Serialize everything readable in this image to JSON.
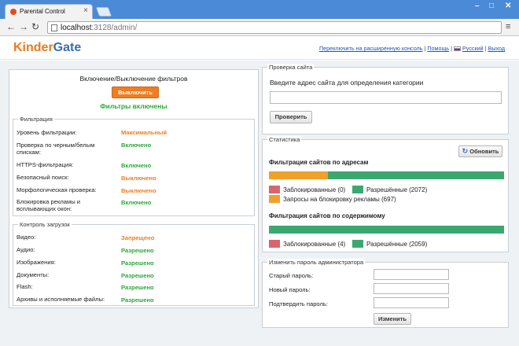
{
  "browser": {
    "tab_title": "Parental Control",
    "tab_close": "×",
    "url_host": "localhost",
    "url_path": ":3128/admin/",
    "window_controls": [
      "–",
      "□",
      "✕"
    ],
    "nav": {
      "back": "←",
      "forward": "→",
      "reload": "↻"
    },
    "menu_glyph": "≡"
  },
  "header": {
    "logo_part1": "Kinder",
    "logo_part2": "Gate",
    "link_console": "Переключить на расширенную консоль",
    "sep1": " | ",
    "link_help": "Помощь",
    "sep2": " | ",
    "link_lang": "Русский",
    "sep3": " | ",
    "link_logout": "Выход"
  },
  "filters_toggle": {
    "title": "Включение/Выключение фильтров",
    "button": "Выключить",
    "status": "Фильтры включены"
  },
  "filtering": {
    "legend": "Фильтрация",
    "rows": [
      {
        "label": "Уровень фильтрации:",
        "value": "Максимальный",
        "status": "orange"
      },
      {
        "label": "Проверка по черным/белым спискам:",
        "value": "Включено",
        "status": "green"
      },
      {
        "label": "HTTPS-фильтрация:",
        "value": "Включено",
        "status": "green"
      },
      {
        "label": "Безопасный поиск:",
        "value": "Выключено",
        "status": "orange"
      },
      {
        "label": "Морфологическая проверка:",
        "value": "Выключено",
        "status": "orange"
      },
      {
        "label": "Блокировка рекламы и всплывающих окон:",
        "value": "Включено",
        "status": "green"
      }
    ]
  },
  "downloads": {
    "legend": "Контроль загрузок",
    "rows": [
      {
        "label": "Видео:",
        "value": "Запрещено",
        "status": "orange"
      },
      {
        "label": "Аудио:",
        "value": "Разрешено",
        "status": "green"
      },
      {
        "label": "Изображения:",
        "value": "Разрешено",
        "status": "green"
      },
      {
        "label": "Документы:",
        "value": "Разрешено",
        "status": "green"
      },
      {
        "label": "Flash:",
        "value": "Разрешено",
        "status": "green"
      },
      {
        "label": "Архивы и исполняемые файлы:",
        "value": "Разрешено",
        "status": "green"
      }
    ]
  },
  "site_check": {
    "legend": "Проверка сайта",
    "prompt": "Введите адрес сайта для определения категории",
    "input_value": "",
    "button": "Проверить"
  },
  "stats": {
    "legend": "Статистика",
    "refresh": "Обновить",
    "by_address": {
      "title": "Фильтрация сайтов по адресам",
      "blocked_label": "Заблокированные (0)",
      "allowed_label": "Разрешённые (2072)",
      "ads_label": "Запросы на блокировку рекламы (697)",
      "blocked": 0,
      "allowed": 2072,
      "ads": 697
    },
    "by_content": {
      "title": "Фильтрация сайтов по содержимому",
      "blocked_label": "Заблокированные (4)",
      "allowed_label": "Разрешённые (2059)",
      "blocked": 4,
      "allowed": 2059
    }
  },
  "password": {
    "legend": "Изменить пароль администратора",
    "old_label": "Старый пароль:",
    "new_label": "Новый пароль:",
    "confirm_label": "Подтвердить пароль:",
    "button": "Изменить"
  },
  "colors": {
    "orange": "#ef7d21",
    "green": "#2aa83a",
    "bar_green": "#3aa870",
    "bar_orange": "#f1a02b",
    "blocked_red": "#d9656b",
    "logo_blue": "#3b6db4"
  }
}
